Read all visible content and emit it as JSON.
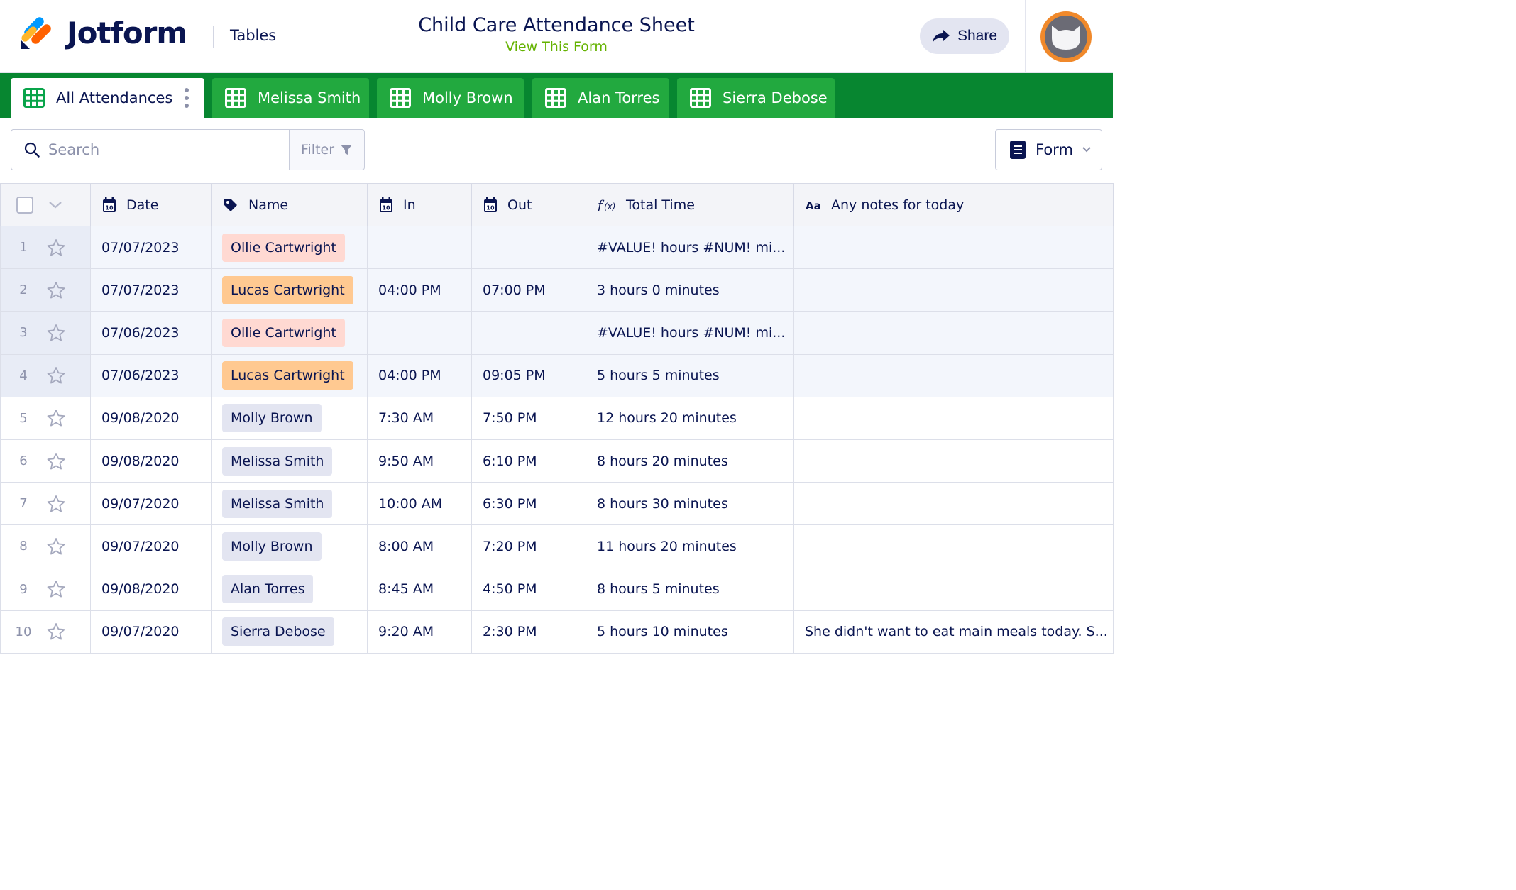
{
  "header": {
    "logo_text": "Jotform",
    "product": "Tables",
    "title": "Child Care Attendance Sheet",
    "subtitle_link": "View This Form",
    "share_label": "Share"
  },
  "tabs": [
    {
      "label": "All Attendances",
      "active": true
    },
    {
      "label": "Melissa Smith",
      "active": false
    },
    {
      "label": "Molly Brown",
      "active": false
    },
    {
      "label": "Alan Torres",
      "active": false
    },
    {
      "label": "Sierra Debose",
      "active": false
    }
  ],
  "toolbar": {
    "search_placeholder": "Search",
    "filter_label": "Filter",
    "form_label": "Form"
  },
  "columns": [
    {
      "label": "Date",
      "icon": "calendar-icon"
    },
    {
      "label": "Name",
      "icon": "tag-icon"
    },
    {
      "label": "In",
      "icon": "calendar-icon"
    },
    {
      "label": "Out",
      "icon": "calendar-icon"
    },
    {
      "label": "Total Time",
      "icon": "formula-icon"
    },
    {
      "label": "Any notes for today",
      "icon": "text-icon"
    }
  ],
  "colors": {
    "tag_pink": "#ffd9d2",
    "tag_orange": "#ffc991",
    "tag_gray": "#e3e5f1",
    "brand_green": "#078630",
    "tab_green": "#22a93f"
  },
  "rows": [
    {
      "n": "1",
      "date": "07/07/2023",
      "name": "Ollie Cartwright",
      "tag": "pink",
      "in": "",
      "out": "",
      "total": "#VALUE! hours #NUM! mi...",
      "notes": "",
      "hl": true
    },
    {
      "n": "2",
      "date": "07/07/2023",
      "name": "Lucas Cartwright",
      "tag": "orange",
      "in": "04:00 PM",
      "out": "07:00 PM",
      "total": "3 hours 0 minutes",
      "notes": "",
      "hl": true
    },
    {
      "n": "3",
      "date": "07/06/2023",
      "name": "Ollie Cartwright",
      "tag": "pink",
      "in": "",
      "out": "",
      "total": "#VALUE! hours #NUM! mi...",
      "notes": "",
      "hl": true
    },
    {
      "n": "4",
      "date": "07/06/2023",
      "name": "Lucas Cartwright",
      "tag": "orange",
      "in": "04:00 PM",
      "out": "09:05 PM",
      "total": "5 hours 5 minutes",
      "notes": "",
      "hl": true
    },
    {
      "n": "5",
      "date": "09/08/2020",
      "name": "Molly Brown",
      "tag": "gray",
      "in": "7:30 AM",
      "out": "7:50 PM",
      "total": "12 hours 20 minutes",
      "notes": "",
      "hl": false
    },
    {
      "n": "6",
      "date": "09/08/2020",
      "name": "Melissa Smith",
      "tag": "gray",
      "in": "9:50 AM",
      "out": "6:10 PM",
      "total": "8 hours 20 minutes",
      "notes": "",
      "hl": false
    },
    {
      "n": "7",
      "date": "09/07/2020",
      "name": "Melissa Smith",
      "tag": "gray",
      "in": "10:00 AM",
      "out": "6:30 PM",
      "total": "8 hours 30 minutes",
      "notes": "",
      "hl": false
    },
    {
      "n": "8",
      "date": "09/07/2020",
      "name": "Molly Brown",
      "tag": "gray",
      "in": "8:00 AM",
      "out": "7:20 PM",
      "total": "11 hours 20 minutes",
      "notes": "",
      "hl": false
    },
    {
      "n": "9",
      "date": "09/08/2020",
      "name": "Alan Torres",
      "tag": "gray",
      "in": "8:45 AM",
      "out": "4:50 PM",
      "total": "8 hours 5 minutes",
      "notes": "",
      "hl": false
    },
    {
      "n": "10",
      "date": "09/07/2020",
      "name": "Sierra Debose",
      "tag": "gray",
      "in": "9:20 AM",
      "out": "2:30 PM",
      "total": "5 hours 10 minutes",
      "notes": "She didn't want to eat main meals today. S...",
      "hl": false
    }
  ]
}
